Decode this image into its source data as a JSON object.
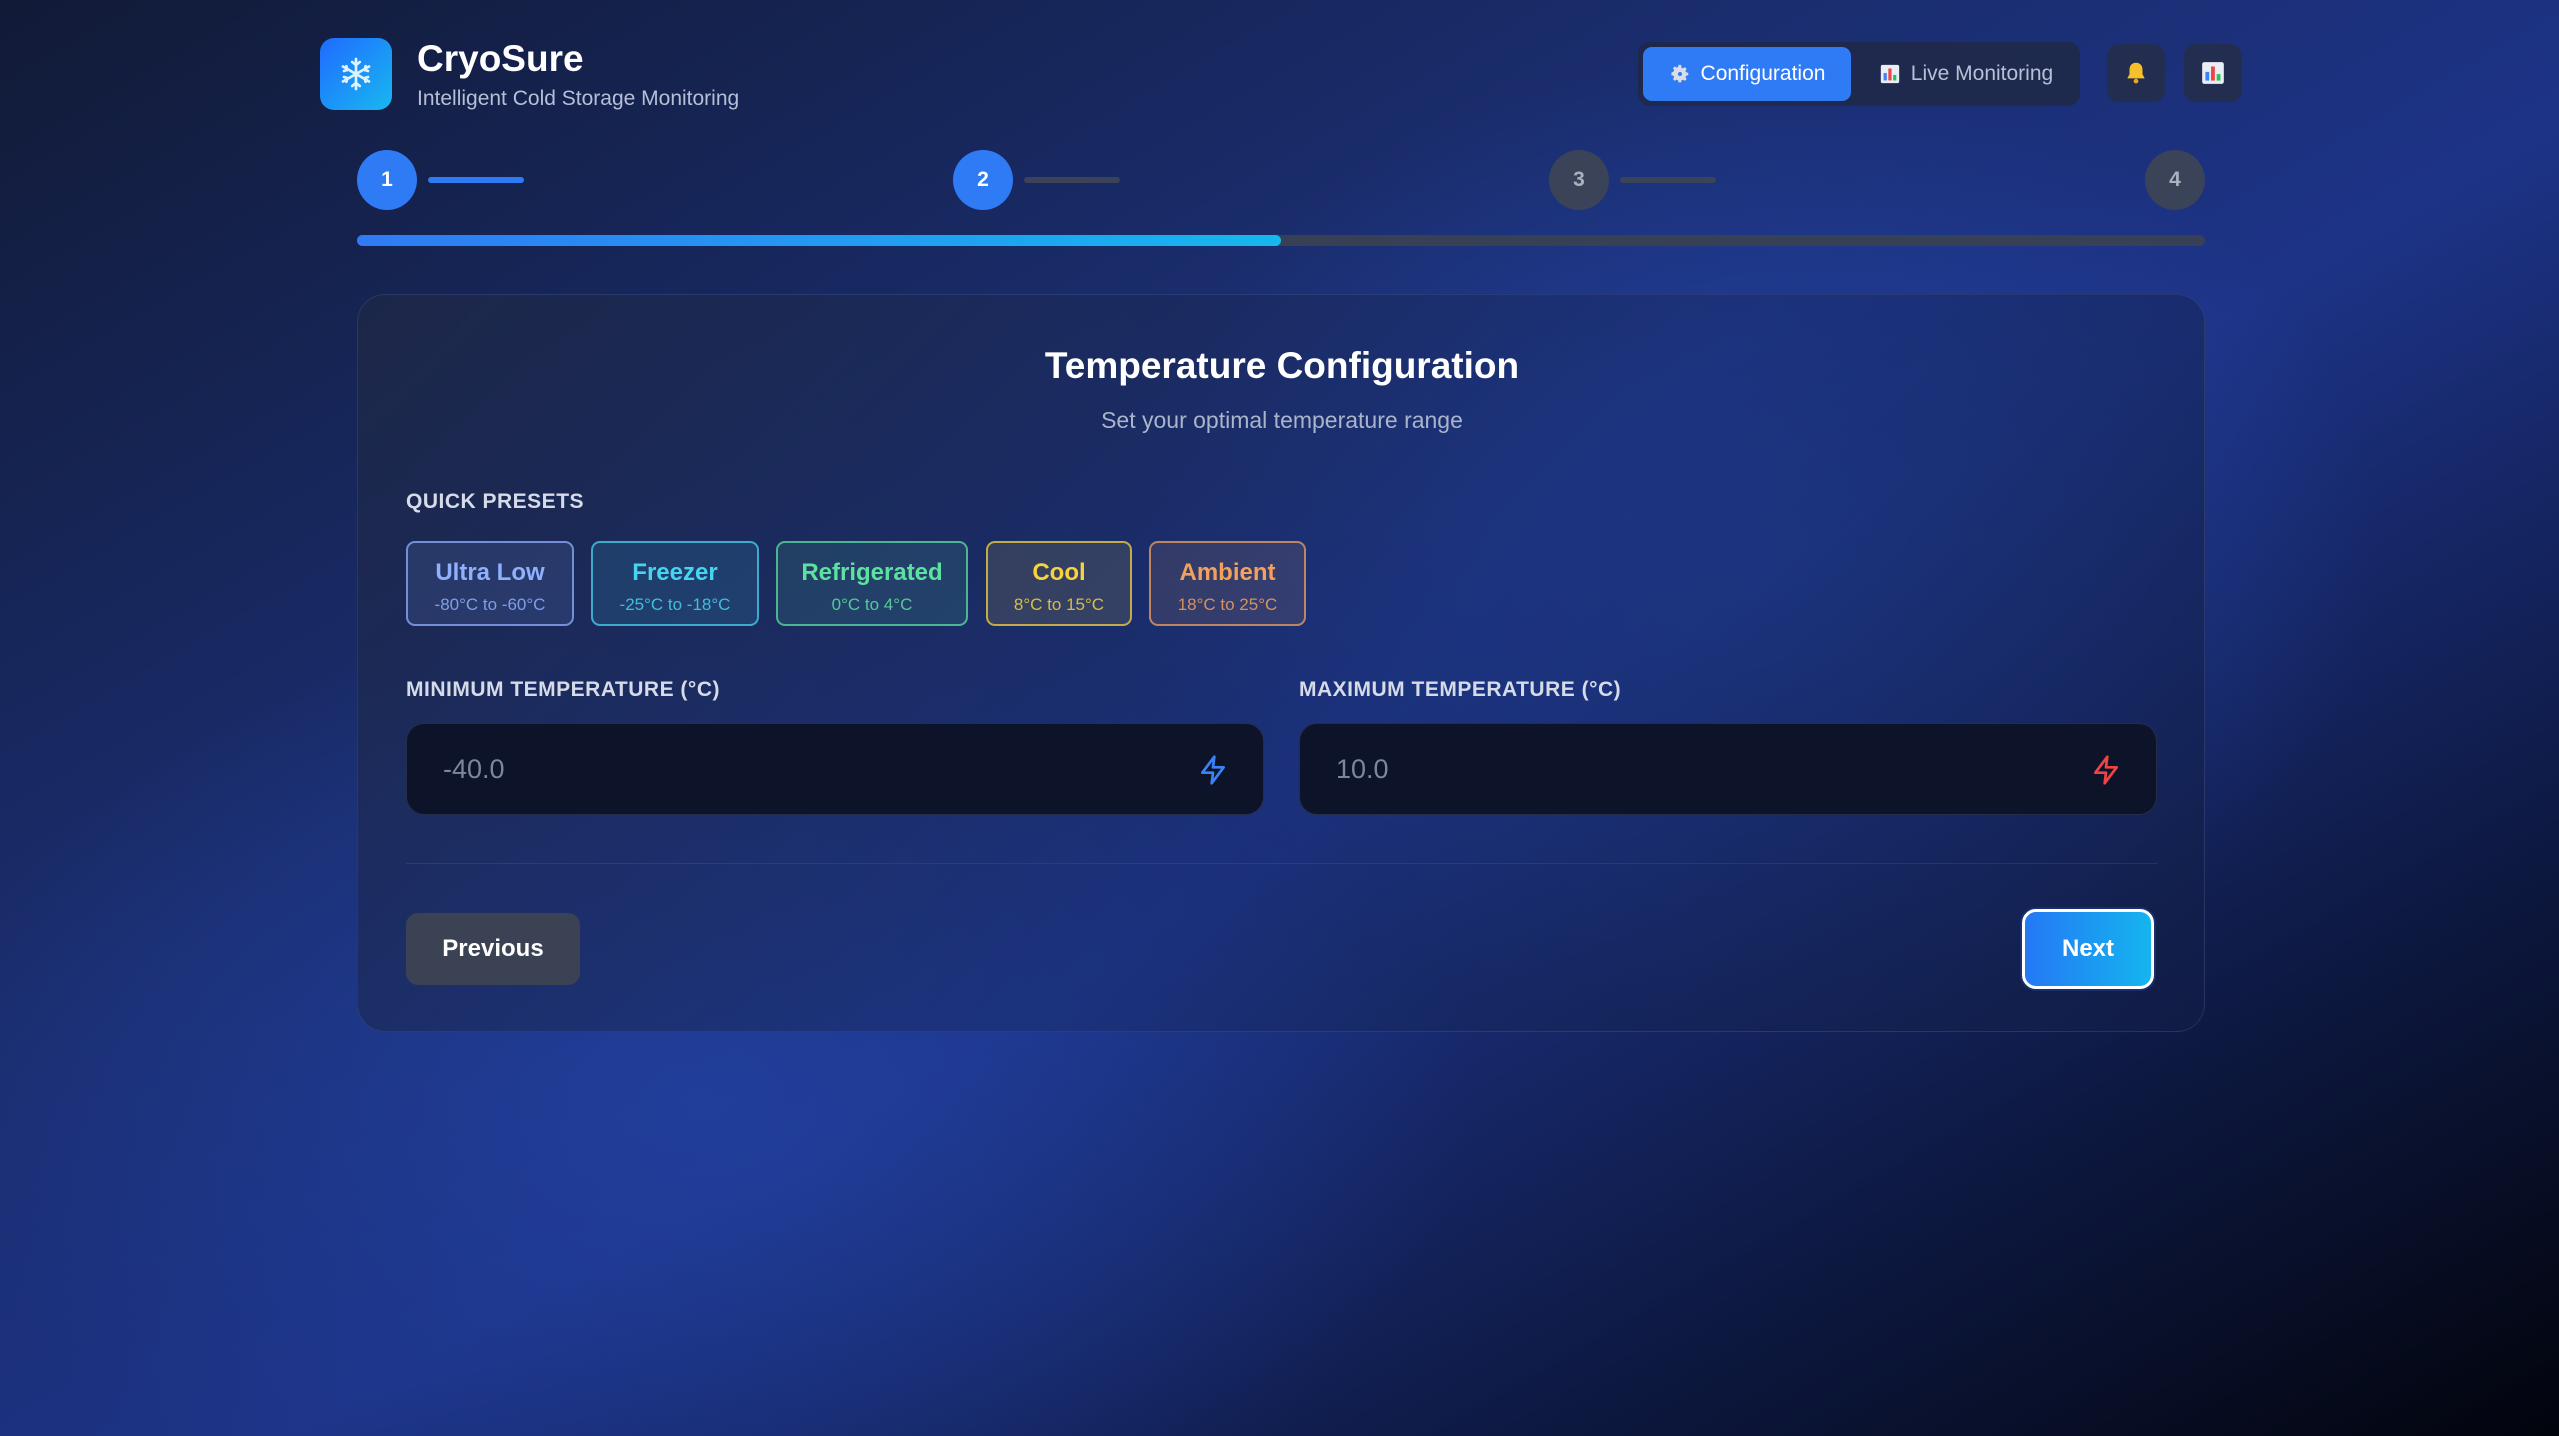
{
  "app": {
    "name": "CryoSure",
    "tagline": "Intelligent Cold Storage Monitoring",
    "logo_icon": "snowflake-icon"
  },
  "nav": {
    "configuration": {
      "icon": "gear-icon",
      "label": "Configuration",
      "active": true
    },
    "live_monitoring": {
      "icon": "bar-chart-icon",
      "label": "Live Monitoring",
      "active": false
    },
    "notifications_icon": "bell-icon",
    "reports_icon": "bar-chart-icon"
  },
  "stepper": {
    "current_step": 2,
    "steps": [
      "1",
      "2",
      "3",
      "4"
    ],
    "progress_percent": 50
  },
  "card": {
    "title": "Temperature Configuration",
    "subtitle": "Set your optimal temperature range"
  },
  "presets": {
    "label": "QUICK PRESETS",
    "items": [
      {
        "name": "Ultra Low",
        "range": "-80°C to -60°C",
        "color": "#8fb0ff"
      },
      {
        "name": "Freezer",
        "range": "-25°C to -18°C",
        "color": "#47d4f0"
      },
      {
        "name": "Refrigerated",
        "range": "0°C to 4°C",
        "color": "#5de0a0"
      },
      {
        "name": "Cool",
        "range": "8°C to 15°C",
        "color": "#f5d33f"
      },
      {
        "name": "Ambient",
        "range": "18°C to 25°C",
        "color": "#f2a15c"
      }
    ]
  },
  "fields": {
    "min": {
      "label": "MINIMUM TEMPERATURE (°C)",
      "placeholder": "-40.0",
      "value": "",
      "icon": "bolt-icon",
      "icon_color": "#3b82f6"
    },
    "max": {
      "label": "MAXIMUM TEMPERATURE (°C)",
      "placeholder": "10.0",
      "value": "",
      "icon": "bolt-icon",
      "icon_color": "#ef4444"
    }
  },
  "actions": {
    "previous": "Previous",
    "next": "Next"
  },
  "colors": {
    "accent": "#2f7bf5",
    "accent_cyan": "#15b5ef"
  }
}
